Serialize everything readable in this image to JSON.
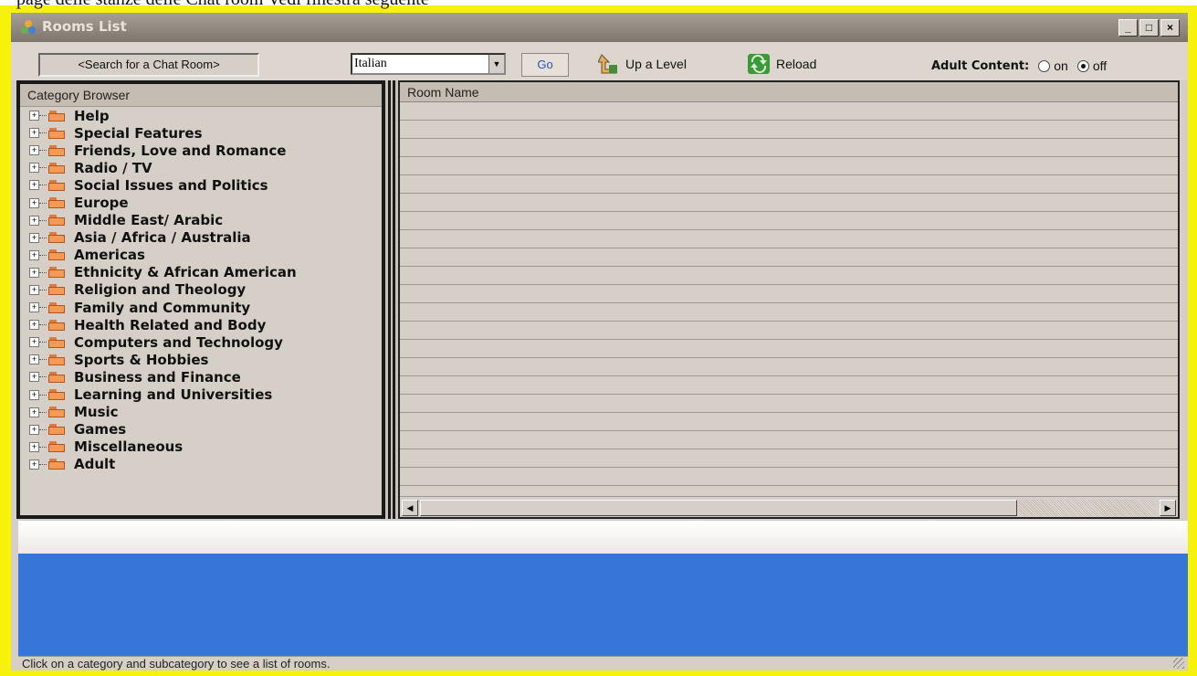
{
  "document_text": "page delle stanze delle Chat room Vedi finestra seguente",
  "window": {
    "title": "Rooms List"
  },
  "toolbar": {
    "search_placeholder": "<Search for a Chat Room>",
    "language": "Italian",
    "go_label": "Go",
    "up_label": "Up a Level",
    "reload_label": "Reload",
    "adult_label": "Adult Content:",
    "adult_on": "on",
    "adult_off": "off",
    "adult_selected": "off"
  },
  "categories": {
    "header": "Category Browser",
    "items": [
      "Help",
      "Special Features",
      "Friends, Love and Romance",
      "Radio / TV",
      "Social Issues and Politics",
      "Europe",
      "Middle East/ Arabic",
      "Asia / Africa / Australia",
      "Americas",
      "Ethnicity & African American",
      "Religion and Theology",
      "Family and Community",
      "Health Related and Body",
      "Computers and Technology",
      "Sports & Hobbies",
      "Business and Finance",
      "Learning and Universities",
      "Music",
      "Games",
      "Miscellaneous",
      "Adult"
    ]
  },
  "rooms": {
    "column_header": "Room Name"
  },
  "status": {
    "text": "Click on a category and subcategory to see a list of rooms."
  },
  "colors": {
    "frame": "#f7f20a",
    "blue_area": "#3776d8",
    "window_bg": "#d6cfc8"
  },
  "icons": [
    "rooms-app-icon",
    "minimize-icon",
    "maximize-icon",
    "close-icon",
    "up-level-icon",
    "reload-icon",
    "folder-icon",
    "expand-icon",
    "dropdown-arrow-icon",
    "scroll-left-icon",
    "scroll-right-icon",
    "resize-grip-icon"
  ]
}
